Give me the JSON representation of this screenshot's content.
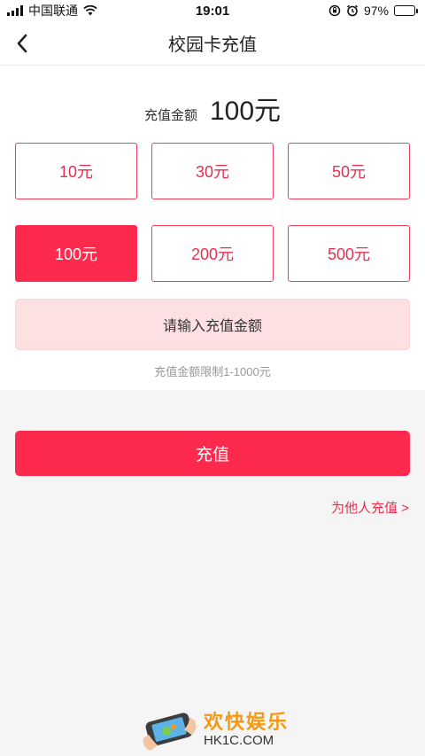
{
  "status_bar": {
    "carrier": "中国联通",
    "time": "19:01",
    "battery": "97%",
    "battery_level": 0.97
  },
  "nav": {
    "back_icon": "chevron-left-icon",
    "title": "校园卡充值"
  },
  "amount": {
    "label": "充值金额",
    "value": "100元"
  },
  "options": [
    {
      "label": "10元",
      "selected": false
    },
    {
      "label": "30元",
      "selected": false
    },
    {
      "label": "50元",
      "selected": false
    },
    {
      "label": "100元",
      "selected": true
    },
    {
      "label": "200元",
      "selected": false
    },
    {
      "label": "500元",
      "selected": false
    }
  ],
  "input": {
    "placeholder": "请输入充值金额"
  },
  "limit_text": "充值金额限制1-1000元",
  "submit_label": "充值",
  "others_link": "为他人充值 >",
  "watermark": {
    "cn": "欢快娱乐",
    "en": "HK1C.COM"
  },
  "colors": {
    "accent": "#fe2a4d",
    "accent_text": "#e3314f",
    "input_bg": "#fde0e2",
    "page_bg": "#f5f5f5"
  }
}
